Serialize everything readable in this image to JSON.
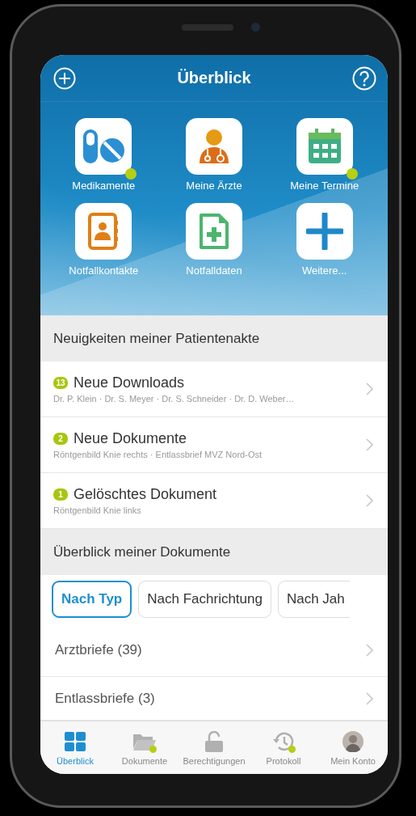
{
  "header": {
    "title": "Überblick"
  },
  "tiles": [
    {
      "label": "Medikamente",
      "badge": true
    },
    {
      "label": "Meine Ärzte",
      "badge": false
    },
    {
      "label": "Meine Termine",
      "badge": true
    },
    {
      "label": "Notfallkontakte",
      "badge": false
    },
    {
      "label": "Notfalldaten",
      "badge": false
    },
    {
      "label": "Weitere...",
      "badge": false
    }
  ],
  "news": {
    "heading": "Neuigkeiten meiner Patientenakte",
    "items": [
      {
        "count": "13",
        "title": "Neue Downloads",
        "subtitle": "Dr. P. Klein · Dr. S. Meyer · Dr. S. Schneider · Dr. D. Weber…"
      },
      {
        "count": "2",
        "title": "Neue Dokumente",
        "subtitle": "Röntgenbild Knie rechts · Entlassbrief MVZ Nord-Ost"
      },
      {
        "count": "1",
        "title": "Gelöschtes Dokument",
        "subtitle": "Röntgenbild Knie links"
      }
    ]
  },
  "documents": {
    "heading": "Überblick meiner Dokumente",
    "filters": [
      {
        "label": "Nach Typ",
        "selected": true
      },
      {
        "label": "Nach Fachrichtung",
        "selected": false
      },
      {
        "label": "Nach Jah",
        "selected": false
      }
    ],
    "rows": [
      "Arztbriefe (39)",
      "Entlassbriefe (3)"
    ]
  },
  "tab_bar": [
    {
      "label": "Überblick",
      "selected": true,
      "badge": false
    },
    {
      "label": "Dokumente",
      "selected": false,
      "badge": true
    },
    {
      "label": "Berechtigungen",
      "selected": false,
      "badge": false
    },
    {
      "label": "Protokoll",
      "selected": false,
      "badge": true
    },
    {
      "label": "Mein Konto",
      "selected": false,
      "badge": false
    }
  ]
}
